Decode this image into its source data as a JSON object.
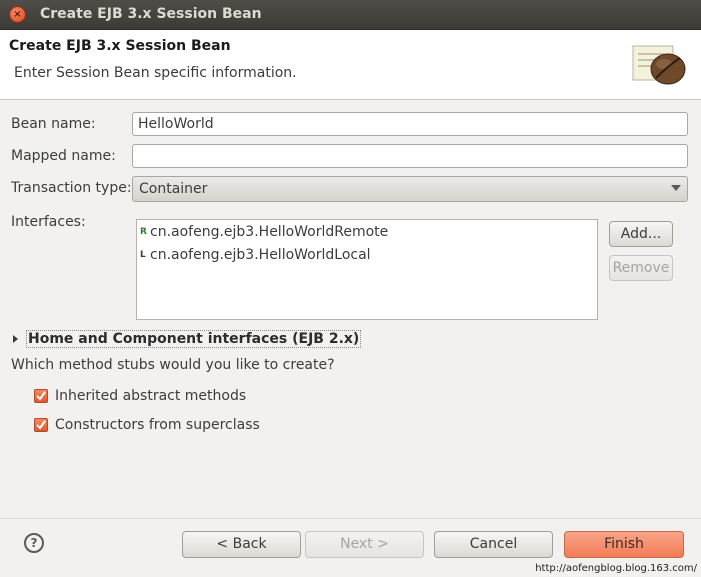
{
  "window": {
    "title": "Create EJB 3.x Session Bean"
  },
  "header": {
    "title": "Create EJB 3.x Session Bean",
    "description": "Enter Session Bean specific information."
  },
  "form": {
    "bean_name_label": "Bean name:",
    "bean_name_value": "HelloWorld",
    "mapped_name_label": "Mapped name:",
    "mapped_name_value": "",
    "transaction_type_label": "Transaction type:",
    "transaction_type_value": "Container",
    "interfaces_label": "Interfaces:",
    "interfaces": [
      {
        "marker": "R",
        "name": "cn.aofeng.ejb3.HelloWorldRemote"
      },
      {
        "marker": "L",
        "name": "cn.aofeng.ejb3.HelloWorldLocal"
      }
    ],
    "add_button": "Add...",
    "remove_button": "Remove"
  },
  "home_section": {
    "label": "Home and Component interfaces (EJB 2.x)"
  },
  "stubs": {
    "question": "Which method stubs would you like to create?",
    "options": [
      {
        "label": "Inherited abstract methods",
        "checked": true
      },
      {
        "label": "Constructors from superclass",
        "checked": true
      }
    ]
  },
  "footer": {
    "help_icon": "help-icon",
    "back_button": "< Back",
    "next_button": "Next >",
    "cancel_button": "Cancel",
    "finish_button": "Finish",
    "watermark": "http://aofengblog.blog.163.com/"
  },
  "colors": {
    "accent": "#f27c55",
    "titlebar": "#3c3b37"
  }
}
